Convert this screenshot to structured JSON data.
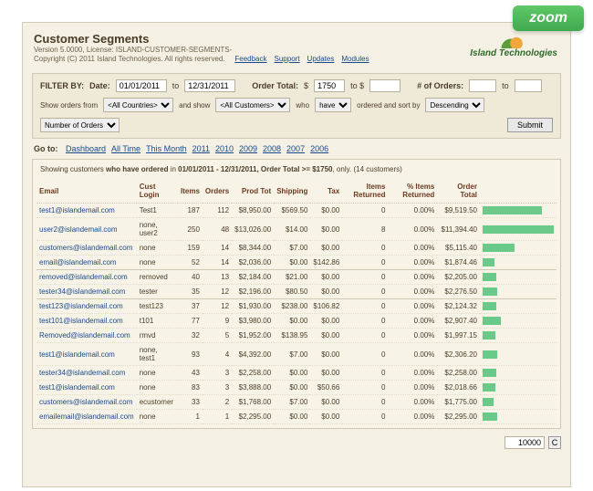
{
  "zoom_label": "zoom",
  "header": {
    "title": "Customer Segments",
    "version": "Version 5.0000, License: ISLAND-CUSTOMER-SEGMENTS-",
    "copyright": "Copyright (C) 2011 Island Technologies. All rights reserved.",
    "links": [
      "Feedback",
      "Support",
      "Updates",
      "Modules"
    ],
    "brand": "Island Technologies"
  },
  "filter": {
    "label": "FILTER BY:",
    "date_label": "Date:",
    "date_from": "01/01/2011",
    "date_to_sep": "to",
    "date_to": "12/31/2011",
    "order_total_label": "Order Total:",
    "dollar": "$",
    "ot_from": "1750",
    "to_sep": "to $",
    "ot_to": "",
    "num_orders_label": "# of Orders:",
    "no_from": "",
    "no_to": "",
    "row2_pre": "Show orders from",
    "countries": "<All Countries>",
    "row2_and": "and show",
    "customers": "<All Customers>",
    "row2_who": "who",
    "have": "have",
    "row2_sort": "ordered and sort by",
    "dir": "Descending",
    "sort_field": "Number of Orders",
    "submit": "Submit"
  },
  "goto": {
    "label": "Go to:",
    "links": [
      "Dashboard",
      "All Time",
      "This Month",
      "2011",
      "2010",
      "2009",
      "2008",
      "2007",
      "2006"
    ]
  },
  "summary": {
    "pre": "Showing customers ",
    "bold1": "who have ordered",
    "mid1": " in ",
    "bold2": "01/01/2011 - 12/31/2011, Order Total >= $1750",
    "post": ", only. (14 customers)"
  },
  "columns": [
    "Email",
    "Cust Login",
    "Items",
    "Orders",
    "Prod Tot",
    "Shipping",
    "Tax",
    "Items Returned",
    "% Items Returned",
    "Order Total",
    ""
  ],
  "max_total": 11394.4,
  "rows": [
    {
      "email": "test1@islandemail.com",
      "login": "Test1",
      "items": 187,
      "orders": 112,
      "prod": "$8,950.00",
      "ship": "$569.50",
      "tax": "$0.00",
      "ret": 0,
      "pret": "0.00%",
      "total": "$9,519.50",
      "val": 9519.5
    },
    {
      "email": "user2@islandemail.com",
      "login": "none, user2",
      "items": 250,
      "orders": 48,
      "prod": "$13,026.00",
      "ship": "$14.00",
      "tax": "$0.00",
      "ret": 8,
      "pret": "0.00%",
      "total": "$11,394.40",
      "val": 11394.4
    },
    {
      "email": "customers@islandemail.com",
      "login": "none",
      "items": 159,
      "orders": 14,
      "prod": "$8,344.00",
      "ship": "$7.00",
      "tax": "$0.00",
      "ret": 0,
      "pret": "0.00%",
      "total": "$5,115.40",
      "val": 5115.4
    },
    {
      "email": "email@islandemail.com",
      "login": "none",
      "items": 52,
      "orders": 14,
      "prod": "$2,036.00",
      "ship": "$0.00",
      "tax": "$142.86",
      "ret": 0,
      "pret": "0.00%",
      "total": "$1,874.46",
      "val": 1874.46,
      "sep": true
    },
    {
      "email": "removed@islandemail.com",
      "login": "removed",
      "items": 40,
      "orders": 13,
      "prod": "$2,184.00",
      "ship": "$21.00",
      "tax": "$0.00",
      "ret": 0,
      "pret": "0.00%",
      "total": "$2,205.00",
      "val": 2205.0
    },
    {
      "email": "tester34@islandemail.com",
      "login": "tester",
      "items": 35,
      "orders": 12,
      "prod": "$2,196.00",
      "ship": "$80.50",
      "tax": "$0.00",
      "ret": 0,
      "pret": "0.00%",
      "total": "$2,276.50",
      "val": 2276.5,
      "sep": true
    },
    {
      "email": "test123@islandemail.com",
      "login": "test123",
      "items": 37,
      "orders": 12,
      "prod": "$1,930.00",
      "ship": "$238.00",
      "tax": "$106.82",
      "ret": 0,
      "pret": "0.00%",
      "total": "$2,124.32",
      "val": 2124.32
    },
    {
      "email": "test101@islandemail.com",
      "login": "t101",
      "items": 77,
      "orders": 9,
      "prod": "$3,980.00",
      "ship": "$0.00",
      "tax": "$0.00",
      "ret": 0,
      "pret": "0.00%",
      "total": "$2,907.40",
      "val": 2907.4
    },
    {
      "email": "Removed@islandemail.com",
      "login": "rmvd",
      "items": 32,
      "orders": 5,
      "prod": "$1,952.00",
      "ship": "$138.95",
      "tax": "$0.00",
      "ret": 0,
      "pret": "0.00%",
      "total": "$1,997.15",
      "val": 1997.15
    },
    {
      "email": "test1@islandemail.com",
      "login": "none, test1",
      "items": 93,
      "orders": 4,
      "prod": "$4,392.00",
      "ship": "$7.00",
      "tax": "$0.00",
      "ret": 0,
      "pret": "0.00%",
      "total": "$2,306.20",
      "val": 2306.2
    },
    {
      "email": "tester34@islandemail.com",
      "login": "none",
      "items": 43,
      "orders": 3,
      "prod": "$2,258.00",
      "ship": "$0.00",
      "tax": "$0.00",
      "ret": 0,
      "pret": "0.00%",
      "total": "$2,258.00",
      "val": 2258.0
    },
    {
      "email": "test1@islandemail.com",
      "login": "none",
      "items": 83,
      "orders": 3,
      "prod": "$3,888.00",
      "ship": "$0.00",
      "tax": "$50.66",
      "ret": 0,
      "pret": "0.00%",
      "total": "$2,018.66",
      "val": 2018.66
    },
    {
      "email": "customers@islandemail.com",
      "login": "ecustomer",
      "items": 33,
      "orders": 2,
      "prod": "$1,768.00",
      "ship": "$7.00",
      "tax": "$0.00",
      "ret": 0,
      "pret": "0.00%",
      "total": "$1,775.00",
      "val": 1775.0
    },
    {
      "email": "emailemail@islandemail.com",
      "login": "none",
      "items": 1,
      "orders": 1,
      "prod": "$2,295.00",
      "ship": "$0.00",
      "tax": "$0.00",
      "ret": 0,
      "pret": "0.00%",
      "total": "$2,295.00",
      "val": 2295.0
    }
  ],
  "footer": {
    "page_size": "10000",
    "refresh": "C"
  }
}
